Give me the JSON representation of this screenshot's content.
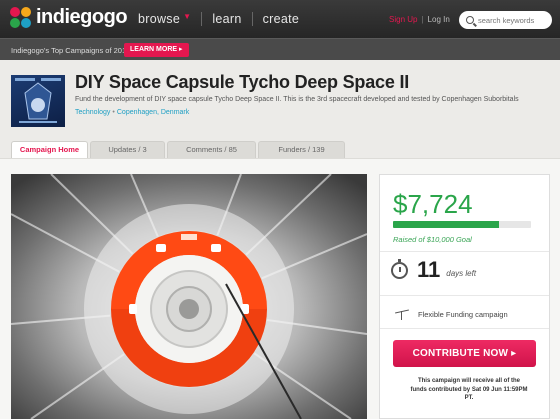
{
  "nav": {
    "logo_text": "indiegogo",
    "browse": "browse",
    "learn": "learn",
    "create": "create",
    "signup": "Sign Up",
    "login": "Log In",
    "search_placeholder": "search keywords"
  },
  "promo": {
    "text": "Indiegogo's Top Campaigns of 2012",
    "button": "LEARN MORE ▸"
  },
  "campaign": {
    "title": "DIY Space Capsule Tycho Deep Space II",
    "subtitle": "Fund the development of DIY space capsule Tycho Deep Space II. This is the 3rd spacecraft developed and tested by Copenhagen Suborbitals",
    "category": "Technology",
    "location": "Copenhagen, Denmark"
  },
  "tabs": [
    {
      "label": "Campaign Home"
    },
    {
      "label": "Updates / 3"
    },
    {
      "label": "Comments / 85"
    },
    {
      "label": "Funders / 139"
    }
  ],
  "funding": {
    "raised": "$7,724",
    "goal_text": "Raised of $10,000 Goal",
    "progress_fraction": 0.77,
    "days_left": "11",
    "days_label": "days left",
    "funding_type": "Flexible Funding campaign",
    "contribute_label": "CONTRIBUTE NOW ▸",
    "receive_text": "This campaign will receive all of the funds contributed by Sat 09 Jun 11:59PM PT."
  },
  "colors": {
    "accent": "#e4174f",
    "green": "#2aa54a",
    "link": "#1e9fc4"
  }
}
